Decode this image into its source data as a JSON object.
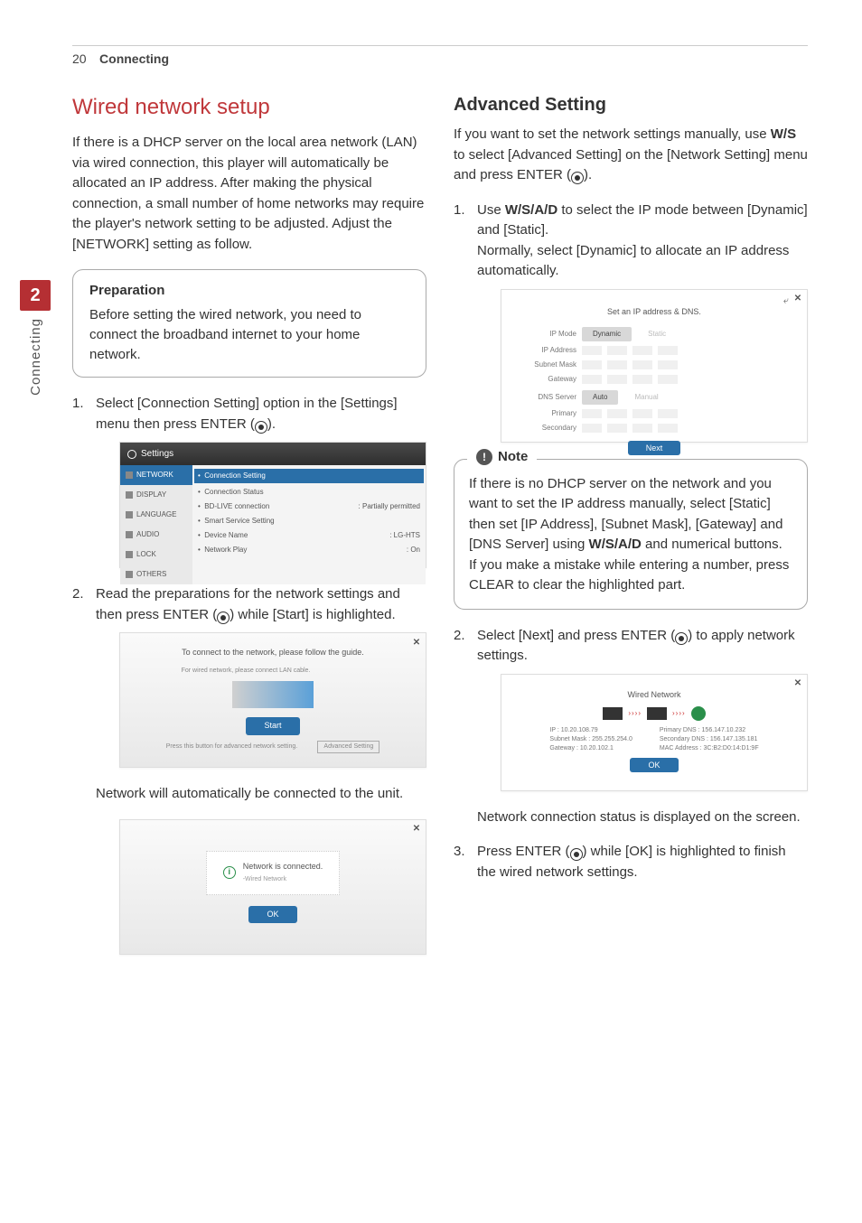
{
  "header": {
    "page_number": "20",
    "section": "Connecting"
  },
  "side_tab": {
    "number": "2",
    "label": "Connecting"
  },
  "left": {
    "title": "Wired network setup",
    "intro": "If there is a DHCP server on the local area network (LAN) via wired connection, this player will automatically be allocated an IP address. After making the physical connection, a small number of home networks may require the player's network setting to be adjusted. Adjust the [NETWORK] setting as follow.",
    "prep": {
      "heading": "Preparation",
      "text": "Before setting the wired network, you need to connect the broadband internet to your home network."
    },
    "step1_prefix": "Select [Connection Setting] option in the [Settings] menu then press ENTER (",
    "step1_suffix": ").",
    "settings_mock": {
      "title": "Settings",
      "side_items": [
        "NETWORK",
        "DISPLAY",
        "LANGUAGE",
        "AUDIO",
        "LOCK",
        "OTHERS"
      ],
      "list": [
        {
          "l": "Connection Setting",
          "r": "",
          "sel": true
        },
        {
          "l": "Connection Status",
          "r": ""
        },
        {
          "l": "BD-LIVE connection",
          "r": ": Partially permitted"
        },
        {
          "l": "Smart Service Setting",
          "r": ""
        },
        {
          "l": "Device Name",
          "r": ": LG-HTS"
        },
        {
          "l": "Network Play",
          "r": ": On"
        }
      ]
    },
    "step2_prefix": "Read the preparations for the network settings and then press ENTER (",
    "step2_suffix": ") while [Start] is highlighted.",
    "wizard_mock": {
      "title": "To connect to the network, please follow the guide.",
      "hint": "For wired network,\nplease connect LAN cable.",
      "start": "Start",
      "footer_left": "Press this button for advanced network setting.",
      "footer_btn": "Advanced Setting"
    },
    "after_wizard": "Network will automatically be connected to the unit.",
    "connected_mock": {
      "line1": "Network is connected.",
      "line2": "-Wired Network",
      "ok": "OK"
    }
  },
  "right": {
    "title": "Advanced Setting",
    "intro_a": "If you want to set the network settings manually, use ",
    "intro_arrows": "W/S",
    "intro_b": " to select [Advanced Setting] on the [Network Setting] menu and press ENTER (",
    "intro_c": ").",
    "step1a": "Use ",
    "step1_arrows": "W/S/A/D",
    "step1b": " to select the IP mode between [Dynamic] and [Static].",
    "step1c": "Normally, select [Dynamic] to allocate an IP address automatically.",
    "ipdns_mock": {
      "title": "Set an IP address & DNS.",
      "ipmode_lbl": "IP Mode",
      "dynamic": "Dynamic",
      "static": "Static",
      "fields1": [
        "IP Address",
        "Subnet Mask",
        "Gateway"
      ],
      "dns_lbl": "DNS Server",
      "auto": "Auto",
      "manual": "Manual",
      "fields2": [
        "Primary",
        "Secondary"
      ],
      "next": "Next"
    },
    "note_label": "Note",
    "note_a": "If there is no DHCP server on the network and you want to set the IP address manually, select [Static] then set [IP Address], [Subnet Mask], [Gateway] and [DNS Server] using ",
    "note_arrows": "W/S/A/D",
    "note_b": " and numerical buttons. If you make a mistake while entering a number, press CLEAR to clear the highlighted part.",
    "step2a": "Select [Next] and press ENTER (",
    "step2b": ") to apply network settings.",
    "result_mock": {
      "title": "Wired Network",
      "left_rows": [
        "IP",
        "Subnet Mask",
        "Gateway"
      ],
      "left_vals": [
        ": 10.20.108.79",
        ": 255.255.254.0",
        ": 10.20.102.1"
      ],
      "right_rows": [
        "Primary DNS",
        "Secondary DNS",
        "MAC Address"
      ],
      "right_vals": [
        ": 156.147.10.232",
        ": 156.147.135.181",
        ": 3C:B2:D0:14:D1:9F"
      ],
      "ok": "OK"
    },
    "after_result": "Network connection status is displayed on the screen.",
    "step3a": "Press ENTER (",
    "step3b": ") while [OK] is highlighted to finish the wired network settings."
  }
}
